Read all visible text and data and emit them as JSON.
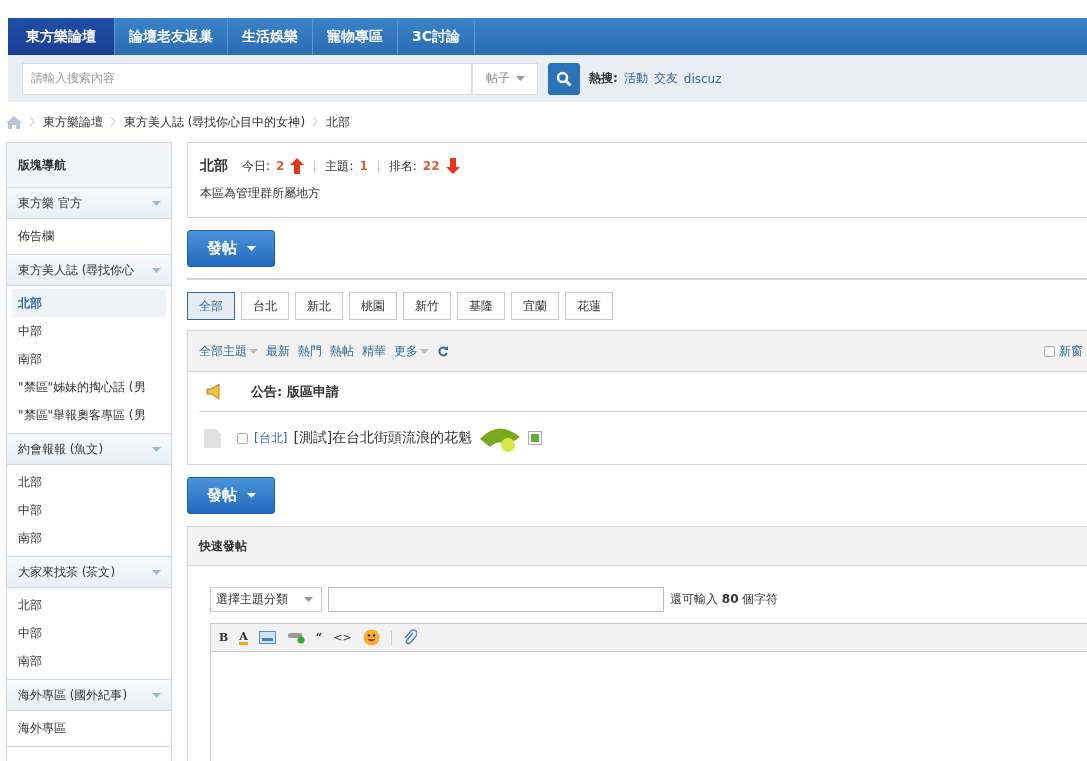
{
  "nav": {
    "tabs": [
      {
        "label": "東方樂論壇",
        "selected": true
      },
      {
        "label": "論壇老友返巢",
        "selected": false
      },
      {
        "label": "生活娛樂",
        "selected": false
      },
      {
        "label": "寵物專區",
        "selected": false
      },
      {
        "label": "3C討論",
        "selected": false
      }
    ]
  },
  "search": {
    "placeholder": "請輸入搜索內容",
    "type": "帖子",
    "hot_label": "熱搜:",
    "hot_links": [
      "活動",
      "交友",
      "discuz"
    ]
  },
  "breadcrumb": [
    "東方樂論壇",
    "東方美人誌 (尋找你心目中的女神)",
    "北部"
  ],
  "sidebar": {
    "title": "版塊導航",
    "groups": [
      {
        "name": "東方樂 官方",
        "expanded": true,
        "items": [
          {
            "label": "佈告欄",
            "selected": false
          }
        ]
      },
      {
        "name": "東方美人誌 (尋找你心",
        "expanded": true,
        "items": [
          {
            "label": "北部",
            "selected": true
          },
          {
            "label": "中部",
            "selected": false
          },
          {
            "label": "南部",
            "selected": false
          },
          {
            "label": "\"禁區\"姊妹的掏心話 (男",
            "selected": false
          },
          {
            "label": "\"禁區\"舉報奧客專區 (男",
            "selected": false
          }
        ]
      },
      {
        "name": "約會報報 (魚文)",
        "expanded": true,
        "items": [
          {
            "label": "北部",
            "selected": false
          },
          {
            "label": "中部",
            "selected": false
          },
          {
            "label": "南部",
            "selected": false
          }
        ]
      },
      {
        "name": "大家來找茶 (茶文)",
        "expanded": true,
        "items": [
          {
            "label": "北部",
            "selected": false
          },
          {
            "label": "中部",
            "selected": false
          },
          {
            "label": "南部",
            "selected": false
          }
        ]
      },
      {
        "name": "海外專區 (國外紀事)",
        "expanded": true,
        "items": [
          {
            "label": "海外專區",
            "selected": false
          }
        ]
      }
    ]
  },
  "forum_info": {
    "name": "北部",
    "stats": [
      {
        "label": "今日:",
        "value": "2",
        "kind": "rise"
      },
      {
        "label": "主題:",
        "value": "1",
        "kind": "plain"
      },
      {
        "label": "排名:",
        "value": "22",
        "kind": "fall"
      }
    ],
    "description": "本區為管理群所屬地方"
  },
  "post_buttons": [
    "發帖",
    "發帖"
  ],
  "filters": [
    {
      "label": "全部",
      "selected": true
    },
    {
      "label": "台北",
      "selected": false
    },
    {
      "label": "新北",
      "selected": false
    },
    {
      "label": "桃園",
      "selected": false
    },
    {
      "label": "新竹",
      "selected": false
    },
    {
      "label": "基隆",
      "selected": false
    },
    {
      "label": "宜蘭",
      "selected": false
    },
    {
      "label": "花蓮",
      "selected": false
    }
  ],
  "thread_list": {
    "toolbar": [
      {
        "label": "全部主題",
        "dropdown": true
      },
      {
        "label": "最新",
        "dropdown": false
      },
      {
        "label": "熱門",
        "dropdown": false
      },
      {
        "label": "熱帖",
        "dropdown": false
      },
      {
        "label": "精華",
        "dropdown": false
      },
      {
        "label": "更多",
        "dropdown": true
      }
    ],
    "new_window": {
      "label": "新窗",
      "checked": false
    },
    "threads": [
      {
        "kind": "announcement",
        "prefix": "公告:",
        "title": "版區申請"
      },
      {
        "kind": "thread",
        "category": "[台北]",
        "title": "[測試]在台北街頭流浪的花魁",
        "is_new": true,
        "checked": false
      }
    ]
  },
  "quick_post": {
    "title": "快速發帖",
    "category_select": "選擇主題分類",
    "remaining": "還可輸入 **80** 個字符",
    "tools": [
      {
        "kind": "bold",
        "label": "B"
      },
      {
        "kind": "color",
        "label": "A"
      },
      {
        "kind": "image"
      },
      {
        "kind": "link"
      },
      {
        "kind": "quote",
        "label": "“"
      },
      {
        "kind": "code",
        "label": "<>"
      },
      {
        "kind": "emoji"
      },
      {
        "kind": "attach"
      }
    ]
  }
}
